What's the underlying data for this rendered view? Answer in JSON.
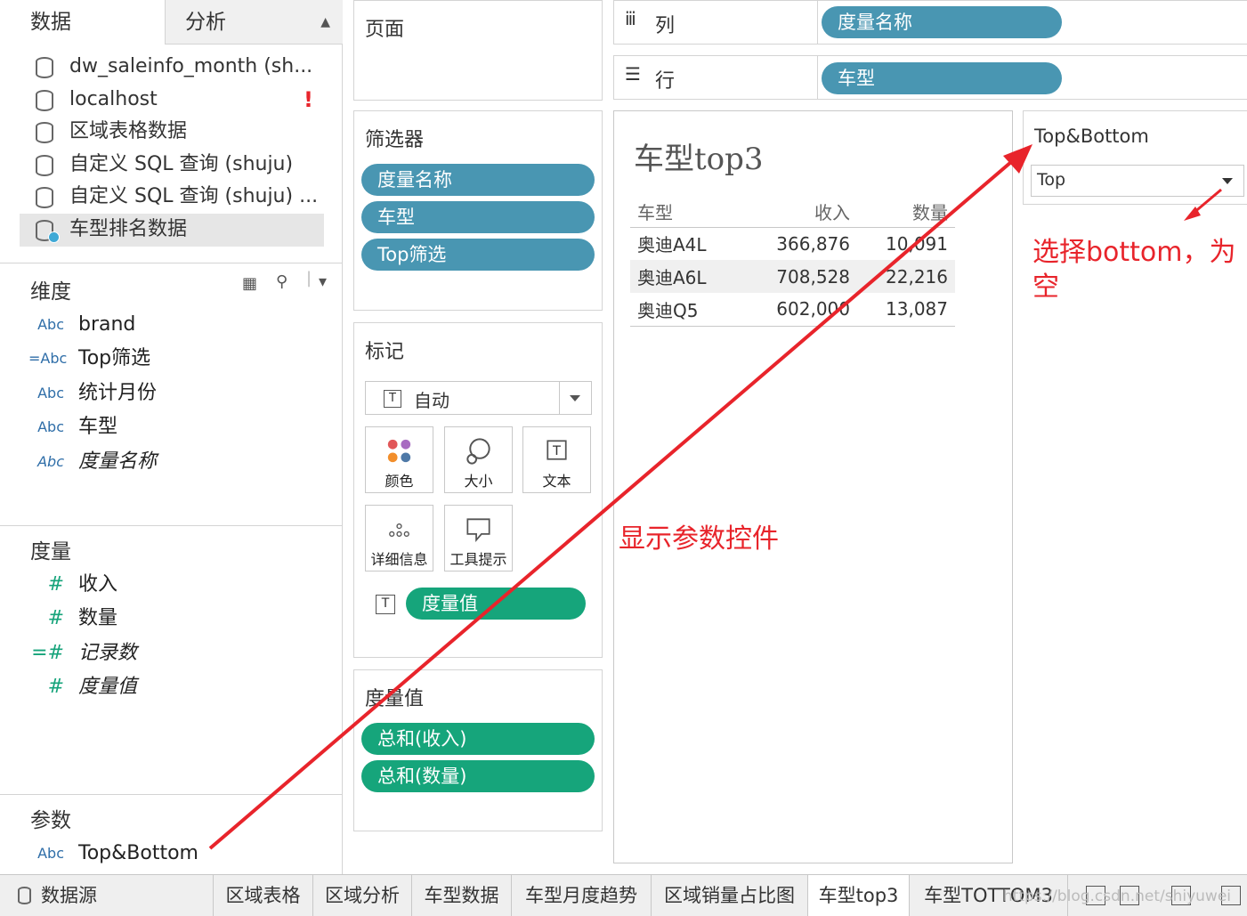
{
  "left_pane": {
    "tabs": {
      "data": "数据",
      "analysis": "分析"
    },
    "datasources": [
      {
        "label": "dw_saleinfo_month (sh..."
      },
      {
        "label": "localhost",
        "warning": "!"
      },
      {
        "label": "区域表格数据"
      },
      {
        "label": "自定义 SQL 查询 (shuju)"
      },
      {
        "label": "自定义 SQL 查询 (shuju) ..."
      },
      {
        "label": "车型排名数据",
        "selected": true
      }
    ],
    "dimensions_title": "维度",
    "dimensions": [
      {
        "type": "Abc",
        "label": "brand"
      },
      {
        "type": "=Abc",
        "label": "Top筛选"
      },
      {
        "type": "Abc",
        "label": "统计月份"
      },
      {
        "type": "Abc",
        "label": "车型"
      },
      {
        "type": "Abc",
        "label": "度量名称",
        "italic": true
      }
    ],
    "measures_title": "度量",
    "measures": [
      {
        "type": "#",
        "label": "收入"
      },
      {
        "type": "#",
        "label": "数量"
      },
      {
        "type": "=#",
        "label": "记录数",
        "italic": true
      },
      {
        "type": "#",
        "label": "度量值",
        "italic": true
      }
    ],
    "parameters_title": "参数",
    "parameters": [
      {
        "type": "Abc",
        "label": "Top&Bottom"
      }
    ]
  },
  "pages": {
    "title": "页面"
  },
  "filters": {
    "title": "筛选器",
    "pills": [
      "度量名称",
      "车型",
      "Top筛选"
    ]
  },
  "marks": {
    "title": "标记",
    "mark_type": "自动",
    "buttons": {
      "color": "颜色",
      "size": "大小",
      "text": "文本",
      "detail": "详细信息",
      "tooltip": "工具提示"
    },
    "text_pill": "度量值"
  },
  "measure_values": {
    "title": "度量值",
    "pills": [
      "总和(收入)",
      "总和(数量)"
    ]
  },
  "shelves": {
    "columns": {
      "label": "列",
      "pill": "度量名称"
    },
    "rows": {
      "label": "行",
      "pill": "车型"
    }
  },
  "view": {
    "title": "车型top3",
    "headers": [
      "车型",
      "收入",
      "数量"
    ],
    "rows": [
      [
        "奥迪A4L",
        "366,876",
        "10,091"
      ],
      [
        "奥迪A6L",
        "708,528",
        "22,216"
      ],
      [
        "奥迪Q5",
        "602,000",
        "13,087"
      ]
    ]
  },
  "parameter_control": {
    "title": "Top&Bottom",
    "value": "Top"
  },
  "annotations": {
    "note1": "选择bottom，为",
    "note2": "空",
    "note3": "显示参数控件"
  },
  "bottom_tabs": {
    "datasource": "数据源",
    "sheets": [
      "区域表格",
      "区域分析",
      "车型数据",
      "车型月度趋势",
      "区域销量占比图",
      "车型top3",
      "车型TOTTOM3"
    ],
    "active": "车型top3"
  },
  "watermark": "https://blog.csdn.net/shiyuwei",
  "colors": {
    "dim_pill": "#4996b2",
    "measure_pill": "#16a57b",
    "annotation": "#e8242b"
  }
}
